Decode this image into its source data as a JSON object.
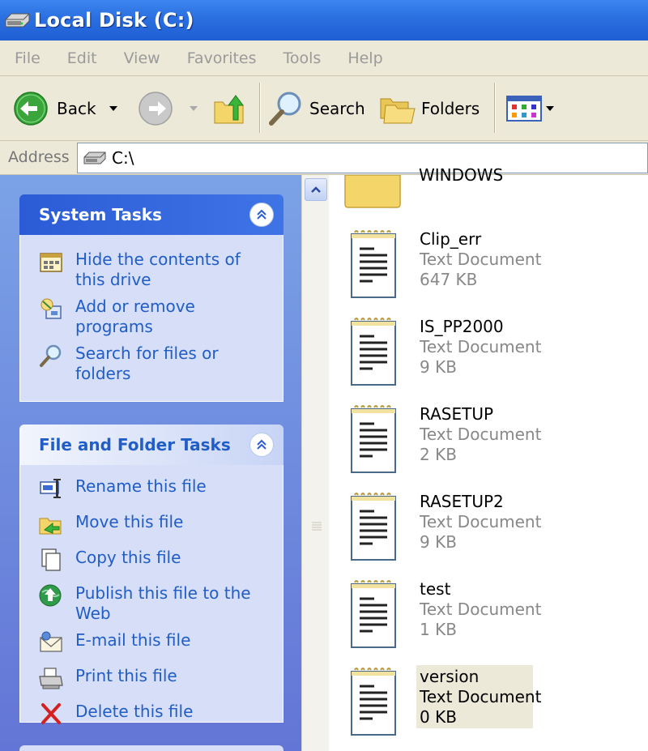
{
  "window": {
    "title": "Local Disk (C:)",
    "icon": "hard-drive-icon"
  },
  "menu": [
    "File",
    "Edit",
    "View",
    "Favorites",
    "Tools",
    "Help"
  ],
  "toolbar": {
    "back_label": "Back",
    "search_label": "Search",
    "folders_label": "Folders"
  },
  "address": {
    "label": "Address",
    "value": "C:\\"
  },
  "system_tasks": {
    "title": "System Tasks",
    "items": [
      {
        "label": "Hide the contents of this drive",
        "icon": "hide-contents-icon"
      },
      {
        "label": "Add or remove programs",
        "icon": "add-remove-programs-icon"
      },
      {
        "label": "Search for files or folders",
        "icon": "search-icon"
      }
    ]
  },
  "file_folder_tasks": {
    "title": "File and Folder Tasks",
    "items": [
      {
        "label": "Rename this file",
        "icon": "rename-icon"
      },
      {
        "label": "Move this file",
        "icon": "move-icon"
      },
      {
        "label": "Copy this file",
        "icon": "copy-icon"
      },
      {
        "label": "Publish this file to the Web",
        "icon": "publish-web-icon"
      },
      {
        "label": "E-mail this file",
        "icon": "email-icon"
      },
      {
        "label": "Print this file",
        "icon": "print-icon"
      },
      {
        "label": "Delete this file",
        "icon": "delete-icon"
      }
    ]
  },
  "folder_partial": {
    "name": "WINDOWS"
  },
  "files": [
    {
      "name": "Clip_err",
      "type": "Text Document",
      "size": "647 KB"
    },
    {
      "name": "IS_PP2000",
      "type": "Text Document",
      "size": "9 KB"
    },
    {
      "name": "RASETUP",
      "type": "Text Document",
      "size": "2 KB"
    },
    {
      "name": "RASETUP2",
      "type": "Text Document",
      "size": "9 KB"
    },
    {
      "name": "test",
      "type": "Text Document",
      "size": "1 KB"
    },
    {
      "name": "version",
      "type": "Text Document",
      "size": "0 KB",
      "selected": true
    }
  ],
  "colors": {
    "titlebar": "#2a6fe0",
    "taskpane": "#6f8fe0",
    "link": "#215dc6",
    "panel_head_blue": "#245edb"
  }
}
